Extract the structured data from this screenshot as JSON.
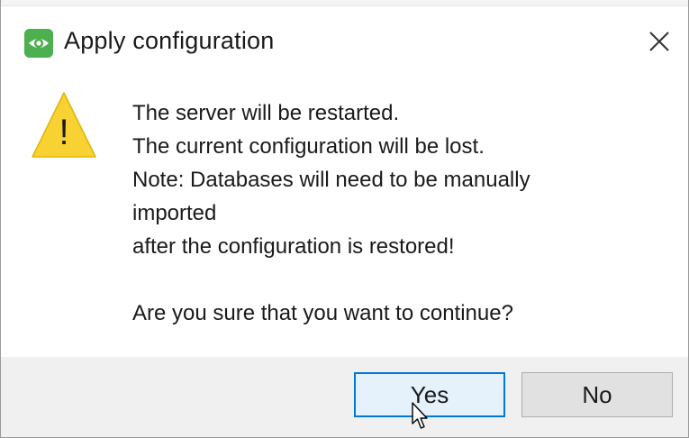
{
  "dialog": {
    "title": "Apply configuration",
    "app_icon": "eye-icon",
    "close_icon": "close-icon",
    "warning_icon": "warning-icon",
    "warning_glyph": "!",
    "message": {
      "line1": "The server will be restarted.",
      "line2": "The current configuration will be lost.",
      "line3": "Note: Databases will need to be manually",
      "line4": "imported",
      "line5": "after the configuration is restored!",
      "line6": "Are you sure that you want to continue?"
    },
    "buttons": {
      "yes_label": "Yes",
      "no_label": "No"
    },
    "colors": {
      "app_icon_green": "#4caf50",
      "warning_yellow": "#f7d232",
      "focus_border": "#0078d7",
      "footer_bg": "#f0f0f0"
    }
  }
}
